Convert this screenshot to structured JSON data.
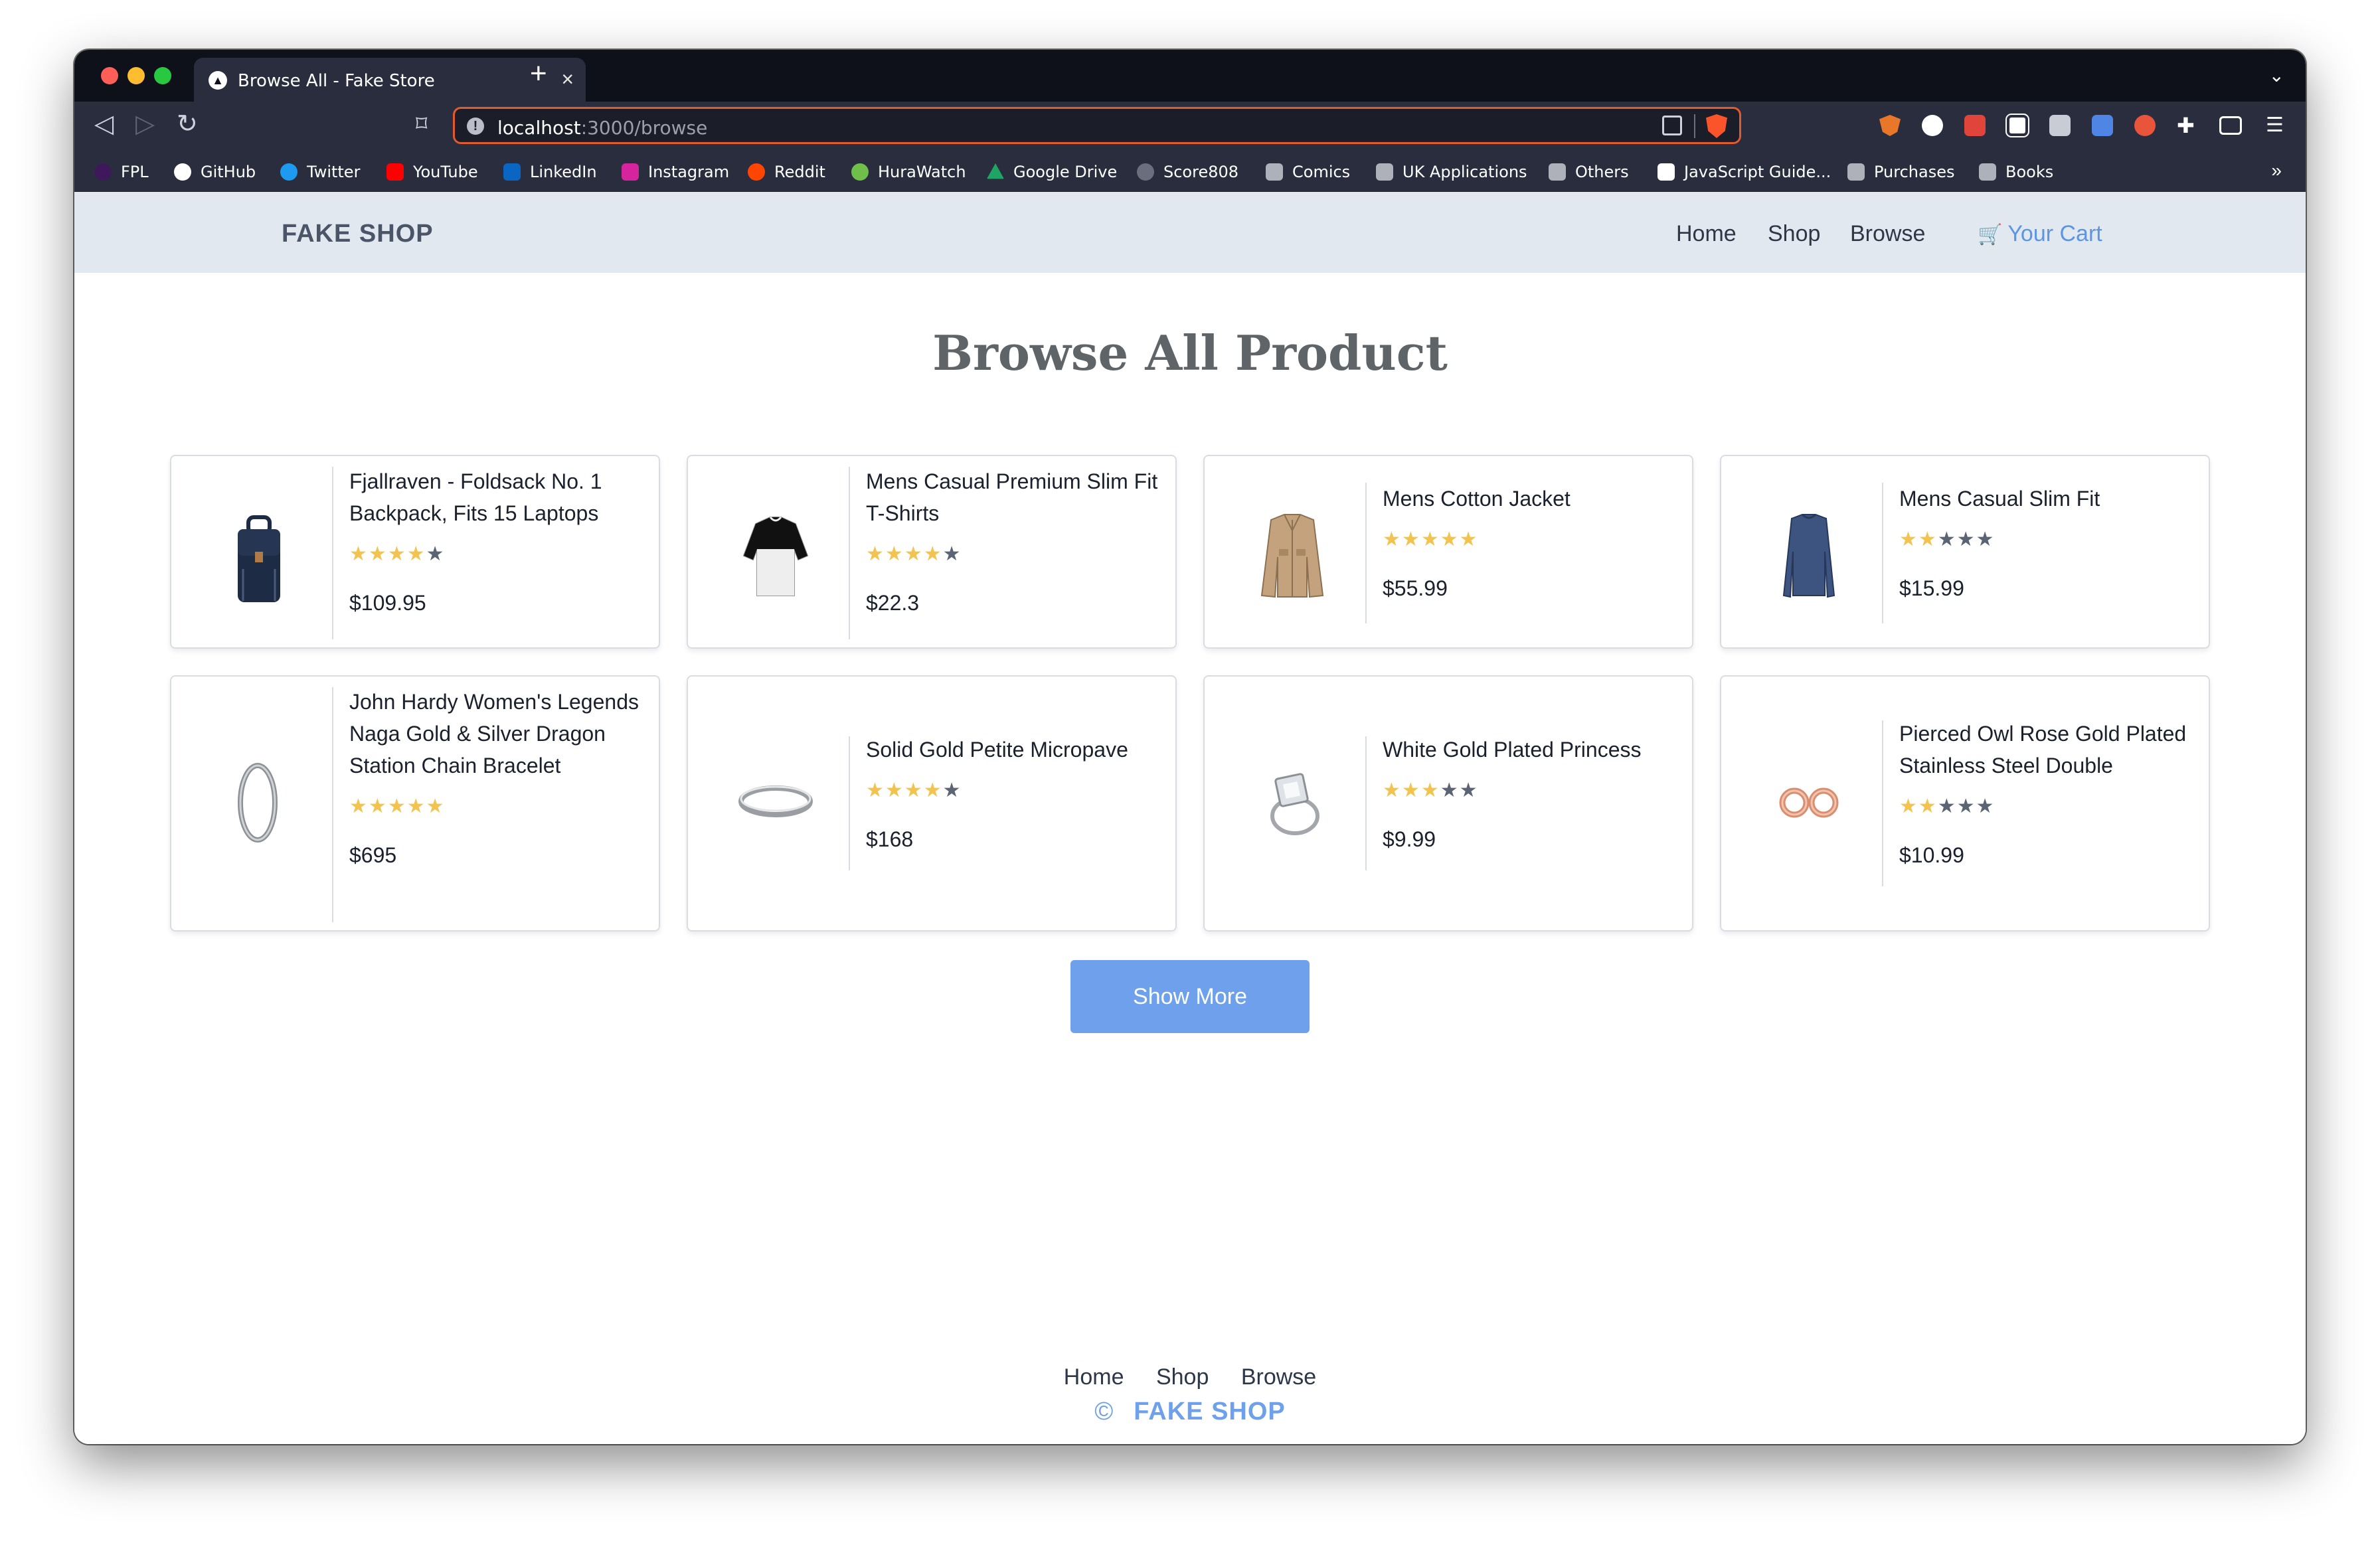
{
  "browser": {
    "tab_title": "Browse All - Fake Store",
    "tab_close": "×",
    "new_tab": "+",
    "url_host": "localhost",
    "url_path": ":3000/browse",
    "bookmarks": [
      "FPL",
      "GitHub",
      "Twitter",
      "YouTube",
      "LinkedIn",
      "Instagram",
      "Reddit",
      "HuraWatch",
      "Google Drive",
      "Score808",
      "Comics",
      "UK Applications",
      "Others",
      "JavaScript Guide...",
      "Purchases",
      "Books"
    ],
    "bookmarks_more": "»"
  },
  "header": {
    "brand": "FAKE SHOP",
    "nav": [
      "Home",
      "Shop",
      "Browse"
    ],
    "cart": "Your Cart",
    "cart_icon": "🛒"
  },
  "main": {
    "title": "Browse All Product",
    "products": [
      {
        "title": "Fjallraven - Foldsack No. 1 Backpack, Fits 15 Laptops",
        "rating": 3.9,
        "price": "$109.95",
        "icon": "backpack-icon"
      },
      {
        "title": "Mens Casual Premium Slim Fit T-Shirts",
        "rating": 4.1,
        "price": "$22.3",
        "icon": "tshirt-icon"
      },
      {
        "title": "Mens Cotton Jacket",
        "rating": 4.7,
        "price": "$55.99",
        "icon": "jacket-icon"
      },
      {
        "title": "Mens Casual Slim Fit",
        "rating": 2.1,
        "price": "$15.99",
        "icon": "longsleeve-icon"
      },
      {
        "title": "John Hardy Women's Legends Naga Gold & Silver Dragon Station Chain Bracelet",
        "rating": 4.6,
        "price": "$695",
        "icon": "bracelet-icon"
      },
      {
        "title": "Solid Gold Petite Micropave",
        "rating": 3.9,
        "price": "$168",
        "icon": "band-ring-icon"
      },
      {
        "title": "White Gold Plated Princess",
        "rating": 3,
        "price": "$9.99",
        "icon": "diamond-ring-icon"
      },
      {
        "title": "Pierced Owl Rose Gold Plated Stainless Steel Double",
        "rating": 1.9,
        "price": "$10.99",
        "icon": "rose-gold-earrings-icon"
      }
    ],
    "show_more": "Show More"
  },
  "footer": {
    "nav": [
      "Home",
      "Shop",
      "Browse"
    ],
    "copyright": "©",
    "brand": "FAKE SHOP"
  },
  "colors": {
    "accent": "#6ea0ec",
    "header_bg": "#e2e8f0",
    "star_on": "#f2c34e",
    "star_off": "#5a6474"
  }
}
